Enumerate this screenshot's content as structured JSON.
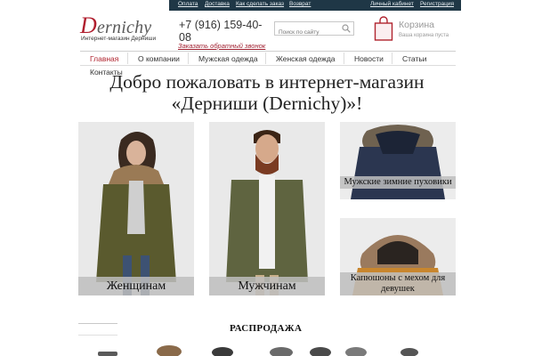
{
  "topbar": {
    "links": [
      "Оплата",
      "Доставка",
      "Как сделать заказ",
      "Возврат"
    ],
    "account": "Личный кабинет",
    "register": "Регистрация"
  },
  "logo": {
    "first_letter": "D",
    "rest": "ernichy",
    "subtitle": "Интернет-магазин Дерниши"
  },
  "phone": "+7 (916) 159-40-08",
  "callback": "Заказать обратный звонок",
  "search": {
    "placeholder": "Поиск по сайту"
  },
  "cart": {
    "title": "Корзина",
    "subtitle": "Ваша корзина пуста"
  },
  "nav": {
    "items": [
      "Главная",
      "О компании",
      "Мужская одежда",
      "Женская одежда",
      "Новости",
      "Статьи",
      "Контакты"
    ],
    "active": "Главная"
  },
  "welcome": "Добро пожаловать в интернет-магазин «Дерниши (Dernichy)»!",
  "tiles": {
    "women": "Женщинам",
    "men": "Мужчинам",
    "mens_winter": "Мужские зимние пуховики",
    "girls_hood": "Капюшоны с мехом для девушек"
  },
  "sale": {
    "title": "РАСПРОДАЖА"
  },
  "colors": {
    "topbar": "#1f3746",
    "accent": "#b0242f",
    "label_bg": "#bebebe"
  }
}
